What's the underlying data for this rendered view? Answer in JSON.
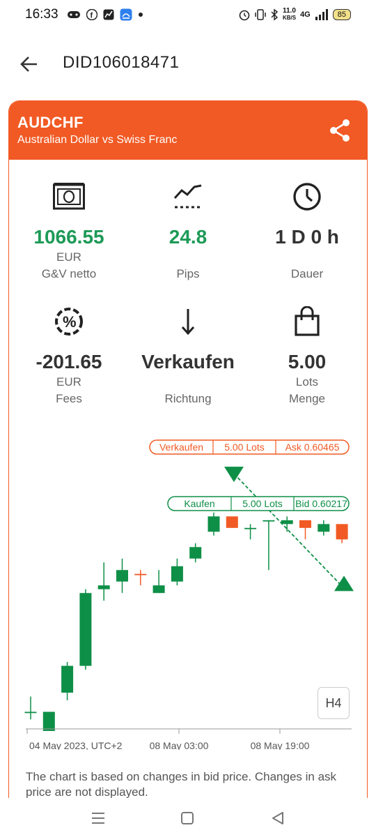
{
  "status": {
    "time": "16:33",
    "net_speed_top": "11.0",
    "net_speed_bottom": "KB/S",
    "network": "4G",
    "battery": "85"
  },
  "header": {
    "title": "DID106018471"
  },
  "card": {
    "symbol": "AUDCHF",
    "description": "Australian Dollar vs Swiss Franc",
    "accent_color": "#f15a24",
    "profit_color": "#1d9a57"
  },
  "stats": [
    {
      "icon": "money-icon",
      "value": "1066.55",
      "unit": "EUR",
      "label": "G&V netto"
    },
    {
      "icon": "trend-icon",
      "value": "24.8",
      "unit": "",
      "label": "Pips"
    },
    {
      "icon": "clock-icon",
      "value": "1 D 0 h",
      "unit": "",
      "label": "Dauer"
    },
    {
      "icon": "percent-icon",
      "value": "-201.65",
      "unit": "EUR",
      "label": "Fees"
    },
    {
      "icon": "arrow-down-icon",
      "value": "Verkaufen",
      "unit": "",
      "label": "Richtung"
    },
    {
      "icon": "bag-icon",
      "value": "5.00",
      "unit": "Lots",
      "label": "Menge"
    }
  ],
  "chart": {
    "timeframe_button": "H4",
    "x_labels": [
      "04 May 2023, UTC+2",
      "08 May 03:00",
      "08 May 19:00"
    ],
    "sell_label": {
      "direction": "Verkaufen",
      "lots": "5.00 Lots",
      "price": "Ask 0.60465"
    },
    "buy_label": {
      "direction": "Kaufen",
      "lots": "5.00 Lots",
      "price": "Bid 0.60217"
    },
    "note": "The chart is based on changes in bid price. Changes in ask price are not displayed."
  },
  "chart_data": {
    "type": "candlestick",
    "timeframe": "H4",
    "green_color": "#0e8f47",
    "red_color": "#f15a24",
    "ylim": [
      0.5985,
      0.606
    ],
    "candles": [
      {
        "o": 0.5988,
        "h": 0.5992,
        "l": 0.5986,
        "c": 0.5988
      },
      {
        "o": 0.5988,
        "h": 0.5988,
        "l": 0.5983,
        "c": 0.5983
      },
      {
        "o": 0.5993,
        "h": 0.6001,
        "l": 0.5991,
        "c": 0.6
      },
      {
        "o": 0.6,
        "h": 0.602,
        "l": 0.5999,
        "c": 0.6019
      },
      {
        "o": 0.602,
        "h": 0.6027,
        "l": 0.6017,
        "c": 0.6021
      },
      {
        "o": 0.6022,
        "h": 0.6028,
        "l": 0.6019,
        "c": 0.6025
      },
      {
        "o": 0.6024,
        "h": 0.6025,
        "l": 0.6021,
        "c": 0.6024
      },
      {
        "o": 0.6019,
        "h": 0.6025,
        "l": 0.6019,
        "c": 0.6021
      },
      {
        "o": 0.6022,
        "h": 0.6028,
        "l": 0.6021,
        "c": 0.6026
      },
      {
        "o": 0.6028,
        "h": 0.6032,
        "l": 0.6027,
        "c": 0.6031
      },
      {
        "o": 0.6035,
        "h": 0.604,
        "l": 0.6034,
        "c": 0.6039
      },
      {
        "o": 0.6039,
        "h": 0.6039,
        "l": 0.6036,
        "c": 0.6036
      },
      {
        "o": 0.6036,
        "h": 0.6037,
        "l": 0.6033,
        "c": 0.6036
      },
      {
        "o": 0.6038,
        "h": 0.6038,
        "l": 0.6025,
        "c": 0.6038
      },
      {
        "o": 0.6037,
        "h": 0.6039,
        "l": 0.6035,
        "c": 0.6038
      },
      {
        "o": 0.6038,
        "h": 0.6038,
        "l": 0.6033,
        "c": 0.6036
      },
      {
        "o": 0.6035,
        "h": 0.6038,
        "l": 0.6034,
        "c": 0.6037
      },
      {
        "o": 0.6037,
        "h": 0.6037,
        "l": 0.6032,
        "c": 0.6033
      }
    ],
    "sell_price": 0.60465,
    "buy_price": 0.60217
  }
}
